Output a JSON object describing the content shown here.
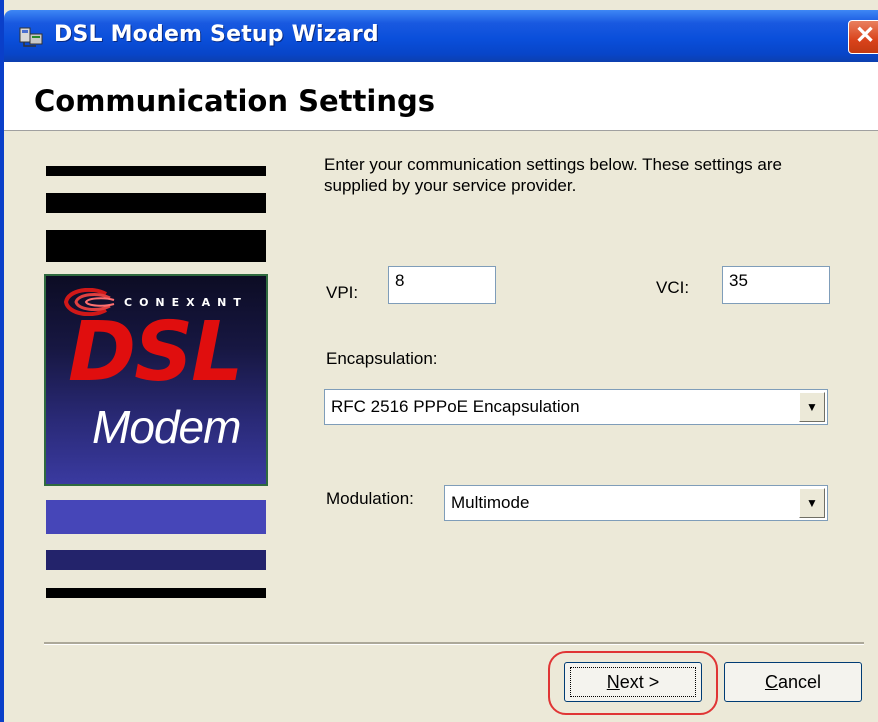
{
  "window": {
    "title": "DSL Modem Setup Wizard",
    "close_glyph": "✕",
    "icon": "modem-setup-icon"
  },
  "header": {
    "title": "Communication Settings"
  },
  "logo": {
    "brand": "CONEXANT",
    "line1": "DSL",
    "line2": "Modem"
  },
  "description": "Enter your communication settings below.  These settings are supplied by your service provider.",
  "fields": {
    "vpi_label": "VPI:",
    "vpi_value": "8",
    "vci_label": "VCI:",
    "vci_value": "35",
    "encapsulation_label": "Encapsulation:",
    "encapsulation_value": "RFC 2516 PPPoE Encapsulation",
    "modulation_label": "Modulation:",
    "modulation_value": "Multimode",
    "dropdown_glyph": "▼"
  },
  "buttons": {
    "next_mnemonic": "N",
    "next_rest": "ext >",
    "cancel_mnemonic": "C",
    "cancel_rest": "ancel"
  },
  "colors": {
    "title_bar": "#0a4fdb",
    "close_button": "#d9431b",
    "dialog_bg": "#ece9d8",
    "highlight": "#e03535"
  }
}
